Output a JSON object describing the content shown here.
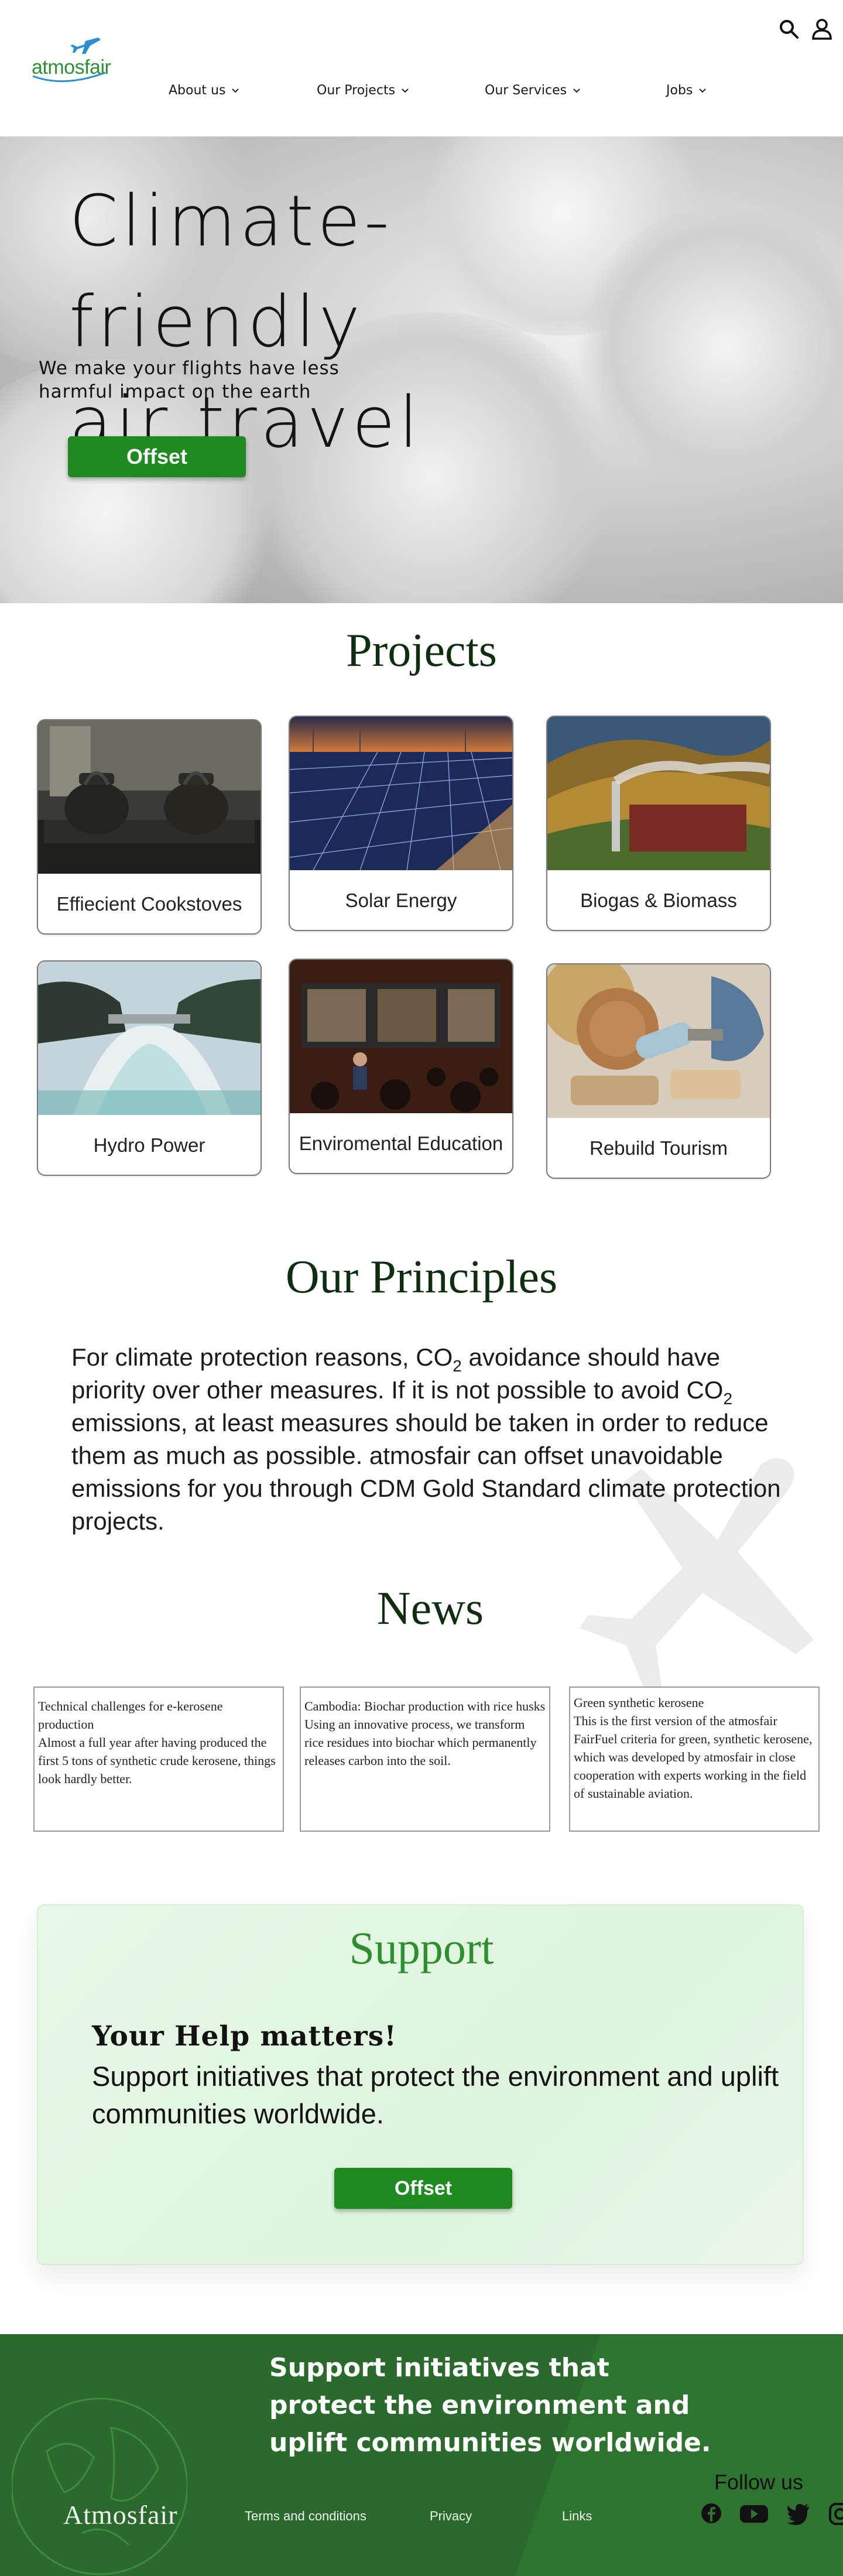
{
  "header": {
    "logo_text": "atmosfair",
    "nav": [
      {
        "label": "About us"
      },
      {
        "label": "Our Projects"
      },
      {
        "label": "Our Services"
      },
      {
        "label": "Jobs"
      }
    ]
  },
  "hero": {
    "title": "Climate-friendly\nair travel",
    "subtitle": "We make your flights have less harmful impact on the earth",
    "cta": "Offset"
  },
  "projects": {
    "title": "Projects",
    "items": [
      {
        "label": "Effiecient Cookstoves"
      },
      {
        "label": "Solar Energy"
      },
      {
        "label": "Biogas & Biomass"
      },
      {
        "label": "Hydro Power"
      },
      {
        "label": "Enviromental Education"
      },
      {
        "label": "Rebuild Tourism"
      }
    ]
  },
  "principles": {
    "title": "Our Principles",
    "part1": "For climate protection reasons, CO",
    "sub1": "2",
    "part2": " avoidance should have priority over other measures. If it is not possible to avoid CO",
    "sub2": "2",
    "part3": " emissions, at least measures should be taken in order to reduce them as much as possible. atmosfair can offset unavoidable emissions for you through CDM Gold Standard climate protection projects."
  },
  "news": {
    "title": "News",
    "items": [
      {
        "title": "Technical challenges for e-kerosene production",
        "body": "Almost a full year after having produced the first 5 tons of synthetic crude kerosene, things look hardly better."
      },
      {
        "title": "Cambodia: Biochar production with rice husks",
        "body": "Using an innovative process, we transform rice residues into biochar which permanently releases carbon into the soil."
      },
      {
        "title": " Green synthetic kerosene",
        "body": "This is the first version of the atmosfair FairFuel criteria for green, synthetic kerosene, which was developed by atmosfair in close cooperation with experts working in the field of sustainable aviation."
      }
    ]
  },
  "support": {
    "title": "Support",
    "heading": "Your Help matters!",
    "text": "Support initiatives that protect the environment and uplift communities worldwide.",
    "cta": "Offset"
  },
  "footer": {
    "headline": "Support initiatives that protect the environment and uplift communities worldwide.",
    "follow": "Follow us",
    "brand": "Atmosfair",
    "links": [
      {
        "label": "Terms and conditions"
      },
      {
        "label": "Privacy"
      },
      {
        "label": "Links"
      }
    ],
    "social": [
      {
        "icon": "facebook-icon"
      },
      {
        "icon": "youtube-icon"
      },
      {
        "icon": "twitter-icon"
      },
      {
        "icon": "instagram-icon"
      }
    ]
  },
  "colors": {
    "brand_green": "#2f8f39",
    "button_green": "#1f8a20",
    "footer_green": "#2a6a2c",
    "support_bg": "#e4f6e3",
    "heading_dark": "#0f2e10"
  }
}
